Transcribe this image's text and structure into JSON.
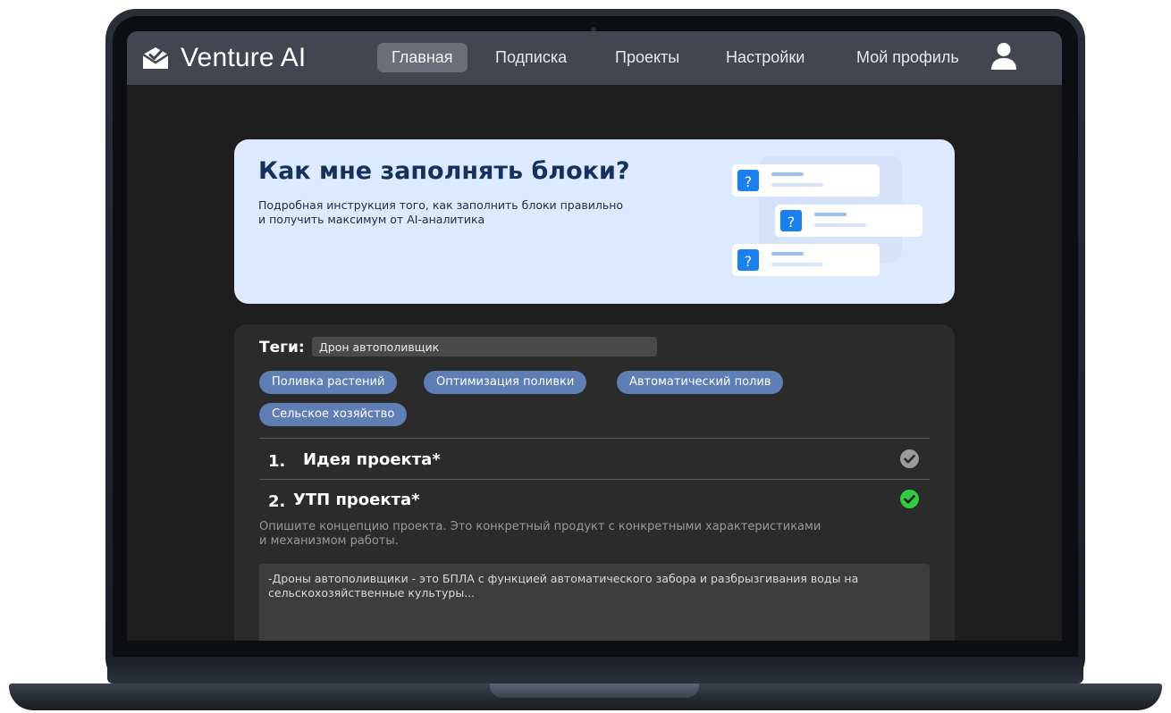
{
  "brand": {
    "name": "Venture AI",
    "logo_icon": "envelope-check-icon"
  },
  "nav": {
    "items": [
      {
        "label": "Главная",
        "active": true
      },
      {
        "label": "Подписка"
      },
      {
        "label": "Проекты"
      },
      {
        "label": "Настройки"
      },
      {
        "label": "Мой профиль"
      }
    ],
    "profile_icon": "user-icon"
  },
  "banner": {
    "title": "Как мне заполнять блоки?",
    "text_line1": "Подробная инструкция того, как заполнить блоки правильно",
    "text_line2": "и получить максимум от AI-аналитика",
    "illustration_marks": [
      "?",
      "?",
      "?"
    ]
  },
  "tags": {
    "label": "Теги:",
    "input_value": "Дрон автополивщик",
    "chips": [
      "Поливка растений",
      "Оптимизация поливки",
      "Автоматический полив",
      "Сельское хозяйство"
    ]
  },
  "sections": [
    {
      "number": "1.",
      "title": "Идея проекта*",
      "status": "incomplete"
    },
    {
      "number": "2.",
      "title": "УТП проекта*",
      "status": "complete",
      "description_line1": "Опишите концепцию проекта. Это конкретный продукт с конкретными характеристиками",
      "description_line2": "и механизмом работы.",
      "answer": "-Дроны автополивщики - это БПЛА с функцией автоматического забора и разбрызгивания воды на сельскохозяйственные культуры..."
    }
  ],
  "colors": {
    "nav_bg": "#434651",
    "banner_bg": "#dde9fe",
    "chip_bg": "#5e7eb5",
    "check_complete": "#2ecc40",
    "check_incomplete": "#9b9b9b",
    "question_badge": "#1a7ff0"
  }
}
